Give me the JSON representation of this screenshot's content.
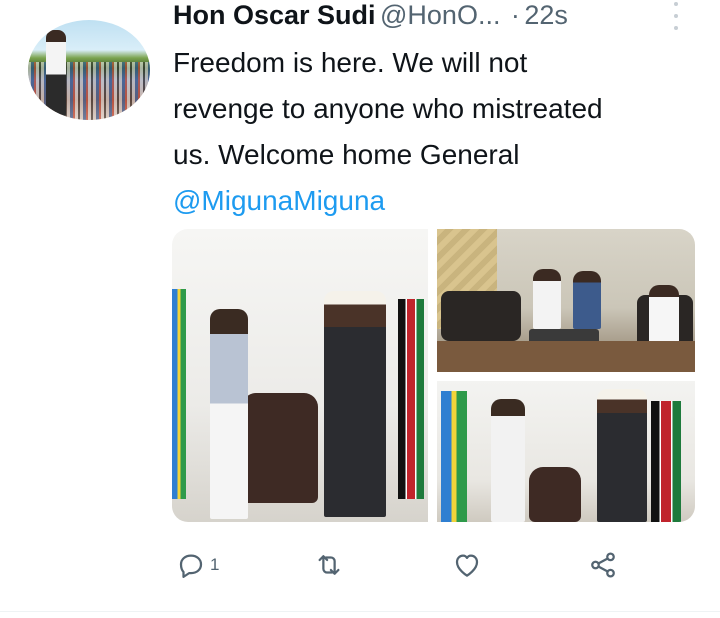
{
  "tweet": {
    "display_name": "Hon Oscar Sudi",
    "handle": "@HonO...",
    "separator": "·",
    "timestamp": "22s",
    "text_lines": [
      "Freedom is here. We will not",
      "revenge to anyone who mistreated",
      "us. Welcome home General"
    ],
    "mention": "@MigunaMiguna",
    "reply_count": "1"
  },
  "icons": {
    "more": "more-vertical-icon",
    "reply": "reply-icon",
    "retweet": "retweet-icon",
    "like": "heart-icon",
    "share": "share-icon"
  },
  "colors": {
    "text": "#0f1419",
    "secondary": "#536471",
    "mention": "#1d9bf0",
    "background": "#ffffff"
  }
}
